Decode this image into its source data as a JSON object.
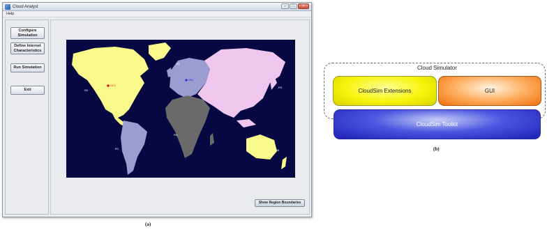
{
  "window": {
    "title": "Cloud Analyst",
    "menu": [
      "Help"
    ],
    "controls": [
      "minimize",
      "maximize",
      "close"
    ]
  },
  "sidebar": {
    "buttons": [
      {
        "label": "Configure Simulation"
      },
      {
        "label": "Define Internet Characteristics"
      },
      {
        "label": "Run Simulation"
      },
      {
        "label": "Exit"
      }
    ]
  },
  "map": {
    "region_labels": [
      "R0",
      "R1",
      "R2",
      "R3",
      "R4",
      "R5"
    ],
    "datacenter_markers": [
      "DC1",
      "UB1"
    ],
    "colors": {
      "ocean": "#070742",
      "north_america": "#fafa8c",
      "south_america": "#9b9cd0",
      "europe": "#9b9cd0",
      "africa": "#6a6a6a",
      "asia": "#efc7ee",
      "oceania": "#fafa8c"
    }
  },
  "main": {
    "show_boundaries_label": "Show Region Boundaries"
  },
  "captions": {
    "a": "(a)",
    "b": "(b)"
  },
  "diagram": {
    "container_title": "Cloud Simulator",
    "blocks": {
      "extensions": "CloudSim Extensions",
      "gui": "GUI",
      "toolkit": "CloudSim Toolkit"
    }
  }
}
